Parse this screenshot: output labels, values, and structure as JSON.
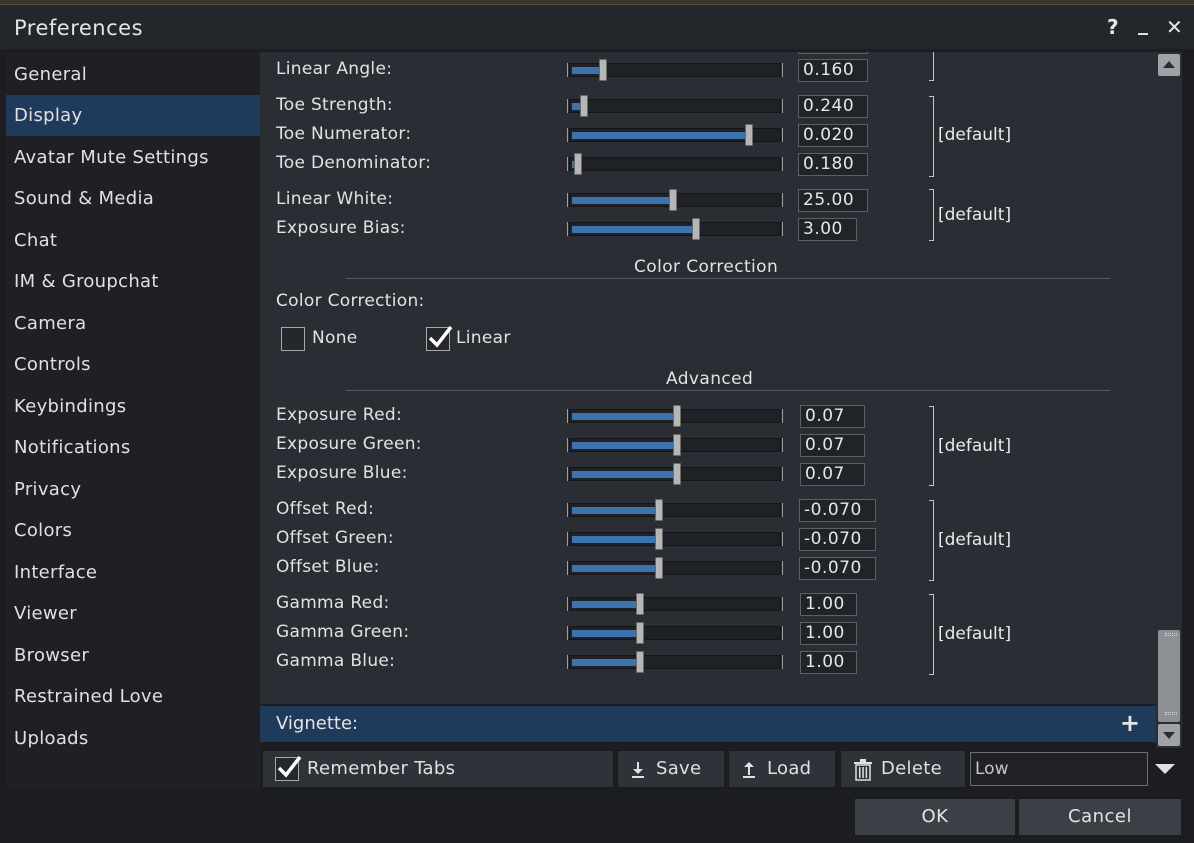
{
  "window": {
    "title": "Preferences",
    "help_glyph": "?",
    "minimize_glyph": "_",
    "close_glyph": "✕"
  },
  "sidebar": {
    "items": [
      {
        "label": "General"
      },
      {
        "label": "Display"
      },
      {
        "label": "Avatar Mute Settings"
      },
      {
        "label": "Sound & Media"
      },
      {
        "label": "Chat"
      },
      {
        "label": "IM & Groupchat"
      },
      {
        "label": "Camera"
      },
      {
        "label": "Controls"
      },
      {
        "label": "Keybindings"
      },
      {
        "label": "Notifications"
      },
      {
        "label": "Privacy"
      },
      {
        "label": "Colors"
      },
      {
        "label": "Interface"
      },
      {
        "label": "Viewer"
      },
      {
        "label": "Browser"
      },
      {
        "label": "Restrained Love"
      },
      {
        "label": "Uploads"
      }
    ],
    "active": "Display"
  },
  "tonemap": {
    "linear_angle": {
      "label": "Linear Angle:",
      "value": "0.160",
      "fraction": 0.15
    },
    "toe_strength": {
      "label": "Toe Strength:",
      "value": "0.240",
      "fraction": 0.06
    },
    "toe_numerator": {
      "label": "Toe Numerator:",
      "value": "0.020",
      "fraction": 0.86
    },
    "toe_denominator": {
      "label": "Toe Denominator:",
      "value": "0.180",
      "fraction": 0.03
    },
    "linear_white": {
      "label": "Linear White:",
      "value": "25.00",
      "fraction": 0.49
    },
    "exposure_bias": {
      "label": "Exposure Bias:",
      "value": "3.00",
      "fraction": 0.6
    },
    "default_label": "[default]"
  },
  "color_correction": {
    "section_title": "Color Correction",
    "field_label": "Color Correction:",
    "none_label": "None",
    "none_checked": false,
    "linear_label": "Linear",
    "linear_checked": true
  },
  "advanced": {
    "section_title": "Advanced",
    "exposure_red": {
      "label": "Exposure Red:",
      "value": "0.07",
      "fraction": 0.51
    },
    "exposure_green": {
      "label": "Exposure Green:",
      "value": "0.07",
      "fraction": 0.51
    },
    "exposure_blue": {
      "label": "Exposure Blue:",
      "value": "0.07",
      "fraction": 0.51
    },
    "offset_red": {
      "label": "Offset Red:",
      "value": "-0.070",
      "fraction": 0.42
    },
    "offset_green": {
      "label": "Offset Green:",
      "value": "-0.070",
      "fraction": 0.42
    },
    "offset_blue": {
      "label": "Offset Blue:",
      "value": "-0.070",
      "fraction": 0.42
    },
    "gamma_red": {
      "label": "Gamma Red:",
      "value": "1.00",
      "fraction": 0.33
    },
    "gamma_green": {
      "label": "Gamma Green:",
      "value": "1.00",
      "fraction": 0.33
    },
    "gamma_blue": {
      "label": "Gamma Blue:",
      "value": "1.00",
      "fraction": 0.33
    },
    "default_label": "[default]"
  },
  "vignette": {
    "label": "Vignette:",
    "expand_glyph": "+"
  },
  "bottom": {
    "remember_tabs_label": "Remember Tabs",
    "remember_tabs_checked": true,
    "save_label": "Save",
    "load_label": "Load",
    "delete_label": "Delete",
    "preset_value": "Low"
  },
  "buttons": {
    "ok_label": "OK",
    "cancel_label": "Cancel"
  },
  "colors": {
    "accent": "#1f3a5a",
    "slider_fill": "#3d73ad",
    "panel_bg": "#2a2d33"
  }
}
